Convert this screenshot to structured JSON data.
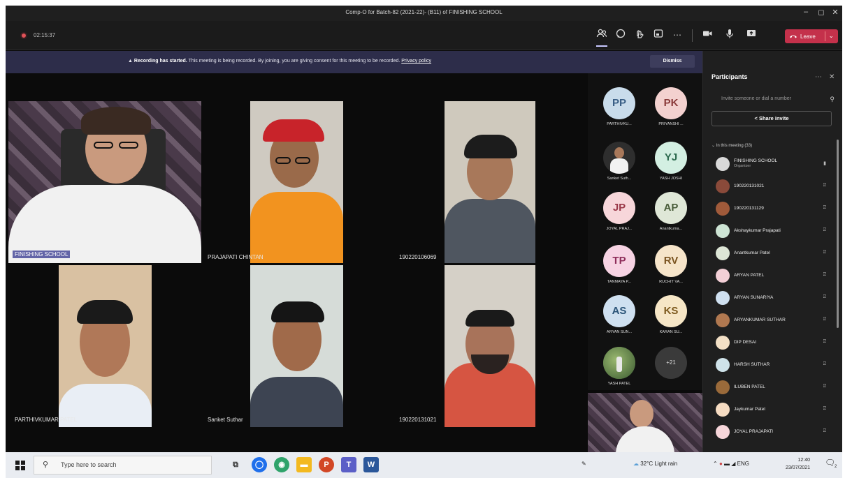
{
  "window": {
    "title": "Comp-O for Batch-82 (2021-22)- (B11) of FINISHING SCHOOL",
    "minimize": "–",
    "maximize": "◻",
    "close": "✕"
  },
  "toolbar": {
    "timer": "02:15:37",
    "leave_label": "Leave",
    "icons": [
      "people-icon",
      "chat-icon",
      "reactions-icon",
      "rooms-icon",
      "more-icon",
      "camera-icon",
      "mic-icon",
      "share-icon"
    ]
  },
  "banner": {
    "strong": "Recording has started.",
    "text": "This meeting is being recorded. By joining, you are giving consent for this meeting to be recorded.",
    "link": "Privacy policy",
    "dismiss": "Dismiss"
  },
  "tiles": [
    {
      "label": "FINISHING SCHOOL"
    },
    {
      "label": "PRAJAPATI CHINTAN"
    },
    {
      "label": "190220106069"
    },
    {
      "label": "PARTHIVKUMAR PATEL"
    },
    {
      "label": "Sanket Suthar"
    },
    {
      "label": "190220131021"
    }
  ],
  "gallery": [
    {
      "initials": "PP",
      "name": "PARTHIVKU...",
      "bg": "#c9dceb",
      "fg": "#3a5f86"
    },
    {
      "initials": "PK",
      "name": "PRIYANSHI ...",
      "bg": "#f3d1cf",
      "fg": "#8a3a3a"
    },
    {
      "initials": "",
      "name": "Sanket Suth...",
      "bg": "#2e2e2e",
      "fg": "#fff"
    },
    {
      "initials": "YJ",
      "name": "YASH JOSHI",
      "bg": "#d3efe2",
      "fg": "#2c6a4e"
    },
    {
      "initials": "JP",
      "name": "JOYAL PRAJ...",
      "bg": "#f7d6da",
      "fg": "#9a3848"
    },
    {
      "initials": "AP",
      "name": "Anantkuma...",
      "bg": "#dfe7d7",
      "fg": "#4a5d3a"
    },
    {
      "initials": "TP",
      "name": "TANMAYA P...",
      "bg": "#f7d3e3",
      "fg": "#8e2d5a"
    },
    {
      "initials": "RV",
      "name": "RUCHIT VA...",
      "bg": "#f6e4c9",
      "fg": "#7a5320"
    },
    {
      "initials": "AS",
      "name": "ARYAN SUN...",
      "bg": "#cfe0f0",
      "fg": "#2b5478"
    },
    {
      "initials": "KS",
      "name": "KARAN SU...",
      "bg": "#f6e6c6",
      "fg": "#7d5a1e"
    },
    {
      "initials": "",
      "name": "YASH PATEL",
      "bg": "#4d6a44",
      "fg": "#fff"
    }
  ],
  "gallery_more": "+21",
  "panel": {
    "title": "Participants",
    "invite_placeholder": "Invite someone or dial a number",
    "share_invite": "Share invite",
    "section": "In this meeting (33)",
    "participants": [
      {
        "name": "FINISHING SCHOOL",
        "role": "Organizer",
        "color": "#d9d9d9"
      },
      {
        "name": "190220131021",
        "role": "",
        "color": "#8a4a3a"
      },
      {
        "name": "190220131129",
        "role": "",
        "color": "#a05a3a"
      },
      {
        "name": "Akshaykumar Prajapati",
        "role": "",
        "color": "#cde4d4"
      },
      {
        "name": "Anantkumar Patel",
        "role": "",
        "color": "#dde6d6"
      },
      {
        "name": "ARYAN PATEL",
        "role": "",
        "color": "#f3cfd6"
      },
      {
        "name": "ARYAN SUNARIYA",
        "role": "",
        "color": "#cfe0f0"
      },
      {
        "name": "ARYANKUMAR SUTHAR",
        "role": "",
        "color": "#b07850"
      },
      {
        "name": "DIP DESAI",
        "role": "",
        "color": "#f3e0c6"
      },
      {
        "name": "HARSH SUTHAR",
        "role": "",
        "color": "#cfe3ea"
      },
      {
        "name": "ILUBEN PATEL",
        "role": "",
        "color": "#9a6a3a"
      },
      {
        "name": "Jaykumar Patel",
        "role": "",
        "color": "#f6dcc2"
      },
      {
        "name": "JOYAL PRAJAPATI",
        "role": "",
        "color": "#f7d6da"
      }
    ]
  },
  "taskbar": {
    "search_placeholder": "Type here to search",
    "weather": "32°C  Light rain",
    "lang": "ENG",
    "time": "12:40",
    "date": "23/07/2021",
    "notif_count": "2"
  }
}
